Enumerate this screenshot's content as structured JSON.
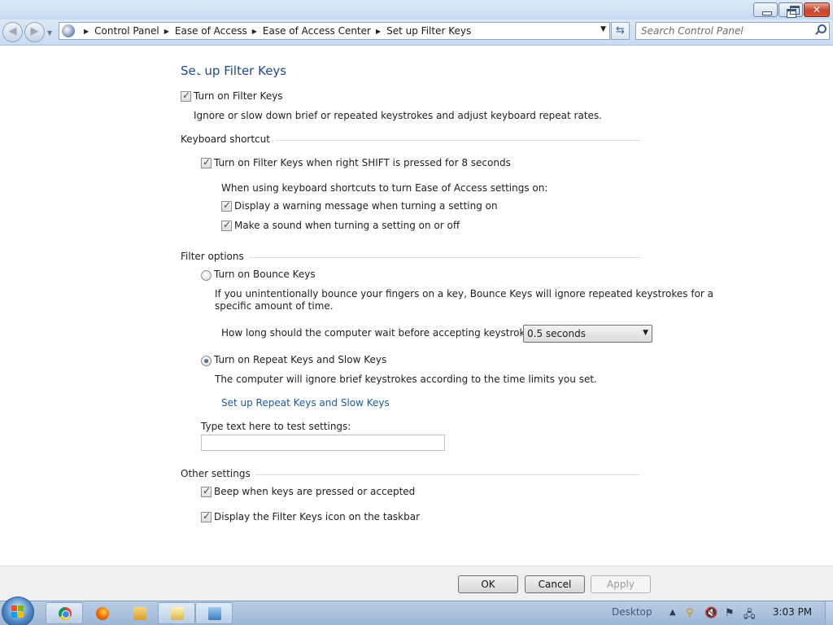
{
  "window": {
    "buttons": [
      "minimize",
      "maximize",
      "close"
    ]
  },
  "nav": {
    "breadcrumbs": [
      "Control Panel",
      "Ease of Access",
      "Ease of Access Center",
      "Set up Filter Keys"
    ],
    "search_placeholder": "Search Control Panel"
  },
  "page": {
    "title": "Set up Filter Keys",
    "turn_on_filter_keys": {
      "label": "Turn on Filter Keys",
      "checked": true
    },
    "description": "Ignore or slow down brief or repeated keystrokes and adjust keyboard repeat rates.",
    "keyboard_shortcut": {
      "header": "Keyboard shortcut",
      "shift_option": {
        "label": "Turn on Filter Keys when right SHIFT is pressed for 8 seconds",
        "checked": true
      },
      "intro": "When using keyboard shortcuts to turn Ease of Access settings on:",
      "warning_option": {
        "label": "Display a warning message when turning a setting on",
        "checked": true
      },
      "sound_option": {
        "label": "Make a sound when turning a setting on or off",
        "checked": true
      }
    },
    "filter_options": {
      "header": "Filter options",
      "bounce": {
        "label": "Turn on Bounce Keys",
        "selected": false,
        "description_line1": "If you unintentionally bounce your fingers on a key, Bounce Keys will ignore repeated keystrokes for a",
        "description_line2": "specific amount of time.",
        "wait_label": "How long should the computer wait before accepting keystrokes?",
        "wait_value": "0.5 seconds"
      },
      "repeat": {
        "label": "Turn on Repeat Keys and Slow Keys",
        "selected": true,
        "description": "The computer will ignore brief keystrokes according to the time limits you set.",
        "setup_link": "Set up Repeat Keys and Slow Keys"
      },
      "test_label": "Type text here to test settings:",
      "test_value": ""
    },
    "other_settings": {
      "header": "Other settings",
      "beep_option": {
        "label": "Beep when keys are pressed or accepted",
        "checked": true
      },
      "icon_option": {
        "label": "Display the Filter Keys icon on the taskbar",
        "checked": true
      }
    }
  },
  "buttons": {
    "ok": "OK",
    "cancel": "Cancel",
    "apply": "Apply"
  },
  "taskbar": {
    "items": [
      "chrome-icon",
      "firefox-icon",
      "explorer-icon",
      "ease-of-access-icon",
      "control-panel-icon"
    ],
    "desktop_label": "Desktop",
    "clock": "3:03 PM"
  }
}
